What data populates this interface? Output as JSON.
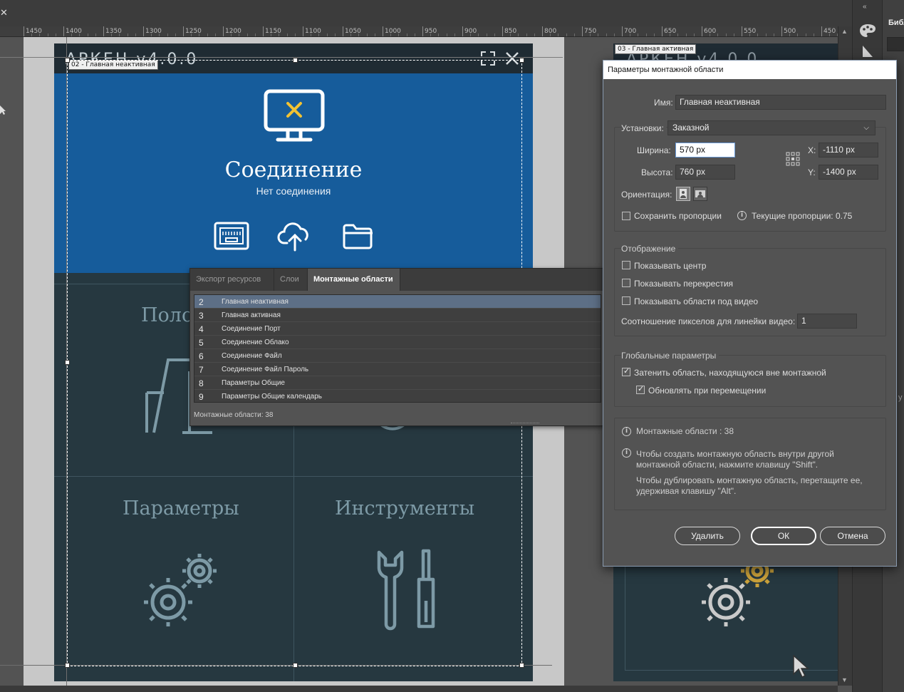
{
  "canvas": {
    "ruler_ticks": [
      "1450",
      "1400",
      "1350",
      "1300",
      "1250",
      "1200",
      "1150",
      "1100",
      "1050",
      "1000",
      "950",
      "900",
      "850",
      "800",
      "750",
      "700",
      "650",
      "600",
      "550",
      "500",
      "450"
    ]
  },
  "artboard_left": {
    "label": "02 - Главная неактивная",
    "logo": "АРКЕН v4.0.0",
    "connection_title": "Соединение",
    "connection_subtitle": "Нет соединения",
    "tile_top_left": "Поло",
    "tile_params": "Параметры",
    "tile_tools": "Инструменты"
  },
  "artboard_right": {
    "label": "03 - Главная активная",
    "logo": "АРКЕН v4.0.0"
  },
  "right_panel": {
    "library_title": "Библ",
    "stub": "у"
  },
  "artboards_panel": {
    "tabs": [
      "Экспорт ресурсов",
      "Слои",
      "Монтажные области"
    ],
    "active_tab": 2,
    "rows": [
      {
        "num": "2",
        "name": "Главная неактивная"
      },
      {
        "num": "3",
        "name": "Главная активная"
      },
      {
        "num": "4",
        "name": "Соединение Порт"
      },
      {
        "num": "5",
        "name": "Соединение Облако"
      },
      {
        "num": "6",
        "name": "Соединение Файл"
      },
      {
        "num": "7",
        "name": "Соединение Файл Пароль"
      },
      {
        "num": "8",
        "name": "Параметры Общие"
      },
      {
        "num": "9",
        "name": "Параметры Общие календарь"
      }
    ],
    "footer": "Монтажные области: 38"
  },
  "dialog": {
    "title": "Параметры монтажной области",
    "name_label": "Имя:",
    "name_value": "Главная неактивная",
    "preset_label": "Установки:",
    "preset_value": "Заказной",
    "width_label": "Ширина:",
    "width_value": "570 px",
    "height_label": "Высота:",
    "height_value": "760 px",
    "x_label": "X:",
    "x_value": "-1110 px",
    "y_label": "Y:",
    "y_value": "-1400 px",
    "orientation_label": "Ориентация:",
    "keep_proportions": "Сохранить пропорции",
    "current_proportions": "Текущие пропорции: 0.75",
    "display_title": "Отображение",
    "show_center": "Показывать центр",
    "show_crosshairs": "Показывать перекрестия",
    "show_video_safe": "Показывать области под видео",
    "pixel_ratio_label": "Соотношение пикселов для линейки видео:",
    "pixel_ratio_value": "1",
    "global_title": "Глобальные параметры",
    "fade_outside": "Затенить область, находящуюся вне монтажной",
    "update_while_dragging": "Обновлять при перемещении",
    "artboards_count": "Монтажные области : 38",
    "hint_shift_1": "Чтобы создать монтажную область внутри другой",
    "hint_shift_2": "монтажной области, нажмите клавишу \"Shift\".",
    "hint_alt_1": "Чтобы дублировать монтажную область, перетащите ее,",
    "hint_alt_2": "удерживая клавишу \"Alt\".",
    "delete_btn": "Удалить",
    "ok_btn": "ОК",
    "cancel_btn": "Отмена"
  }
}
